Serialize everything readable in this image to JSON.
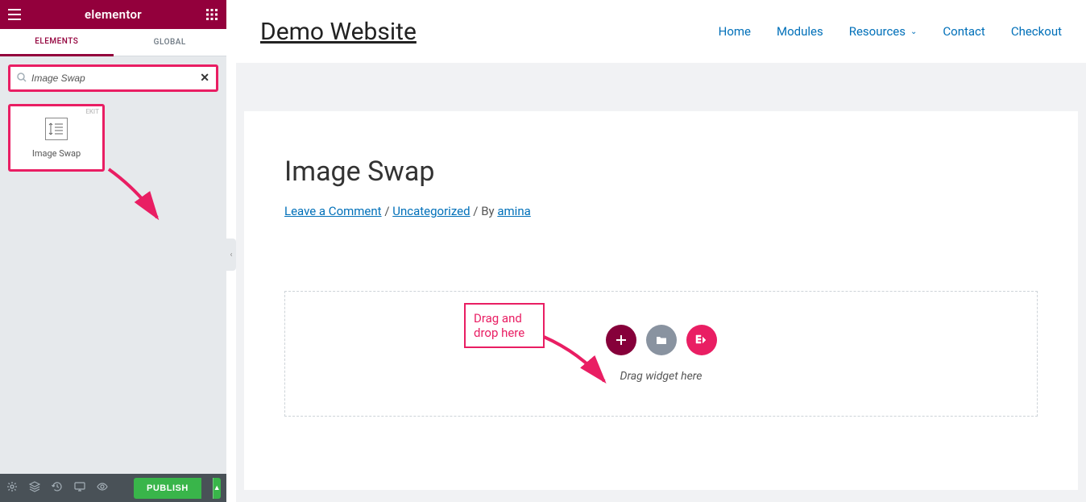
{
  "sidebar": {
    "logo": "elementor",
    "tabs": {
      "elements": "ELEMENTS",
      "global": "GLOBAL"
    },
    "search": {
      "value": "Image Swap",
      "clear": "✕"
    },
    "widget": {
      "badge": "EKIT",
      "label": "Image Swap"
    },
    "footer": {
      "publish": "PUBLISH",
      "split": "▲"
    }
  },
  "nav": {
    "site_title": "Demo Website",
    "home": "Home",
    "modules": "Modules",
    "resources": "Resources",
    "contact": "Contact",
    "checkout": "Checkout"
  },
  "post": {
    "title": "Image Swap",
    "comment_link": "Leave a Comment",
    "sep1": " / ",
    "category": "Uncategorized",
    "sep2": " / By ",
    "author": "amina"
  },
  "dropzone": {
    "text": "Drag widget here"
  },
  "callout": {
    "line1": "Drag and",
    "line2": "drop here"
  },
  "collapse": "‹"
}
